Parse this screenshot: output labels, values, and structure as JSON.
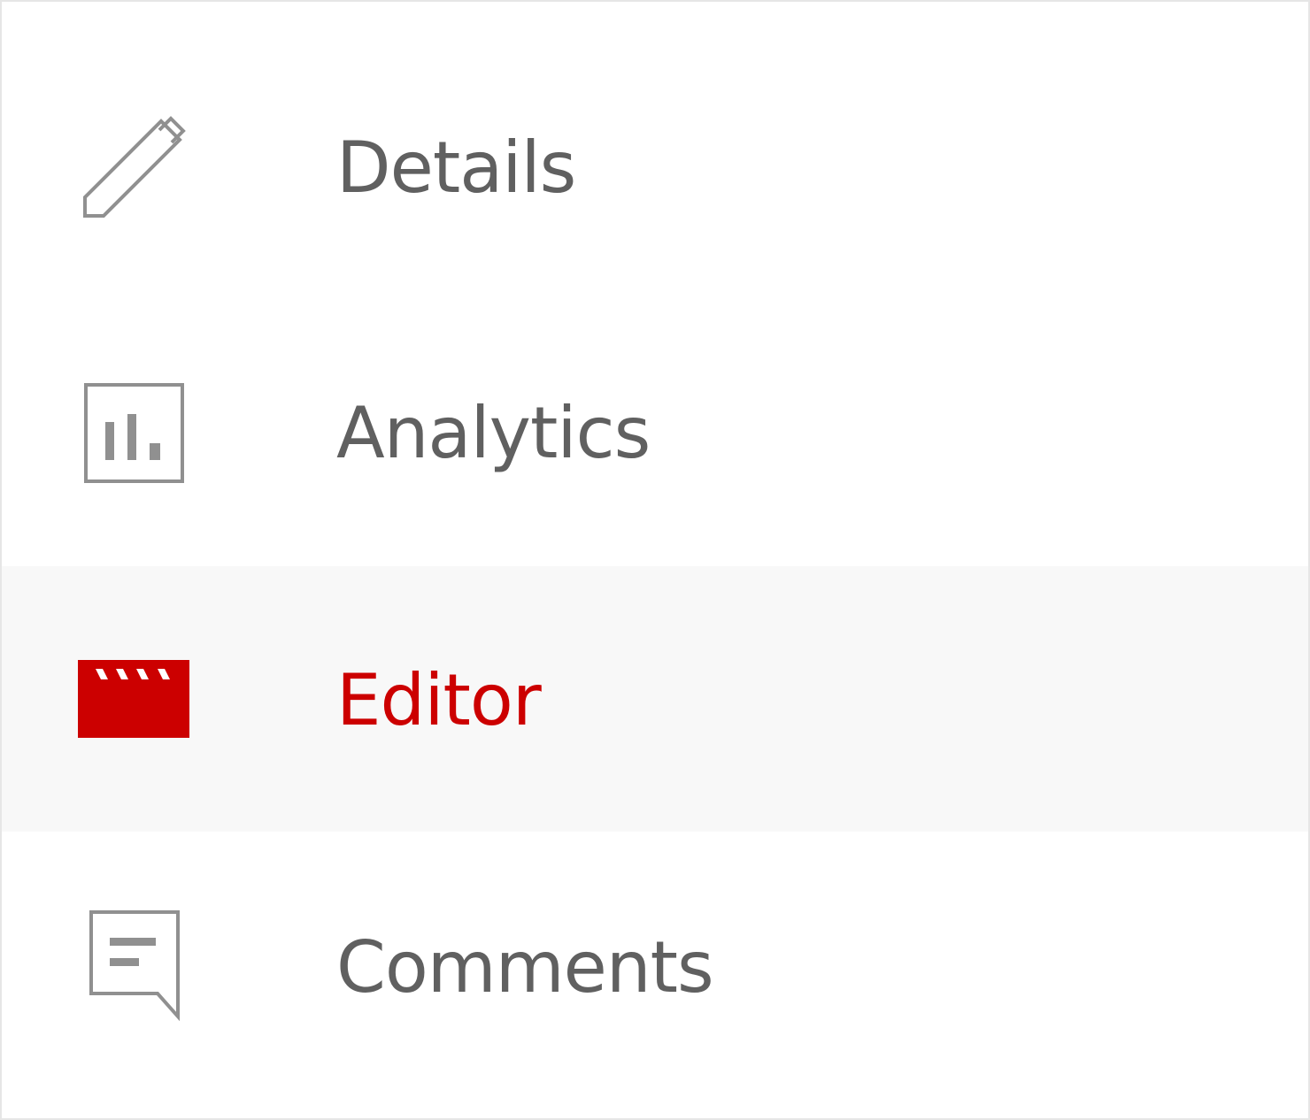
{
  "navigation": {
    "items": [
      {
        "label": "Details",
        "icon": "pencil-icon",
        "active": false
      },
      {
        "label": "Analytics",
        "icon": "analytics-icon",
        "active": false
      },
      {
        "label": "Editor",
        "icon": "clapperboard-icon",
        "active": true
      },
      {
        "label": "Comments",
        "icon": "comment-icon",
        "active": false
      }
    ]
  },
  "colors": {
    "text": "#606060",
    "icon": "#909090",
    "accent": "#cc0000",
    "active_background": "#f8f8f8",
    "border": "#e6e6e6"
  }
}
